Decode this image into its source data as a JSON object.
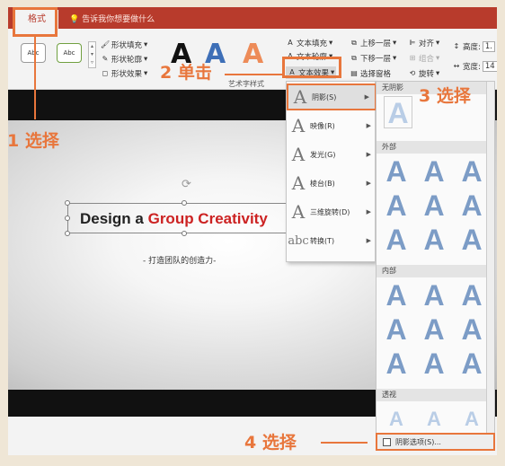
{
  "ribbon": {
    "active_tab": "格式",
    "tell_me": "告诉我你想要做什么",
    "shape_styles": [
      "Abc",
      "Abc"
    ],
    "shape_fill": "形状填充",
    "shape_outline": "形状轮廓",
    "shape_effects": "形状效果",
    "wordart_label": "艺术字样式",
    "text_fill": "文本填充",
    "text_outline": "文本轮廓",
    "text_effects": "文本效果",
    "bring_forward": "上移一层",
    "send_backward": "下移一层",
    "selection_pane": "选择窗格",
    "align": "对齐",
    "group": "组合",
    "rotate": "旋转",
    "height_label": "高度:",
    "height_value": "1.",
    "width_label": "宽度:",
    "width_value": "14"
  },
  "slide": {
    "title_dark": "Design a",
    "title_red": "Group Creativity",
    "subtitle": "- 打造团队的创造力-"
  },
  "effects_menu": [
    {
      "label": "阴影(S)",
      "glyph": "A"
    },
    {
      "label": "映像(R)",
      "glyph": "A"
    },
    {
      "label": "发光(G)",
      "glyph": "A"
    },
    {
      "label": "棱台(B)",
      "glyph": "A"
    },
    {
      "label": "三维旋转(D)",
      "glyph": "A"
    },
    {
      "label": "转换(T)",
      "glyph": "abc"
    }
  ],
  "gallery": {
    "no_shadow": "无阴影",
    "outer": "外部",
    "inner": "内部",
    "perspective": "透视",
    "shadow_options": "阴影选项(S)..."
  },
  "annotations": {
    "step1": "1 选择",
    "step2": "2 单击",
    "step3": "3 选择",
    "step4": "4 选择"
  },
  "colors": {
    "accent": "#b83b2c",
    "highlight": "#e8763c",
    "title_red": "#cc2222"
  }
}
